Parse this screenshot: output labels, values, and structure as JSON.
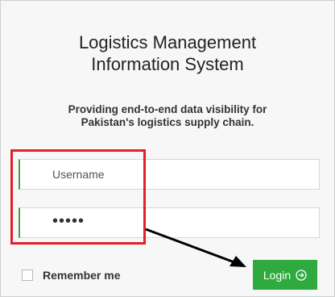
{
  "panel": {
    "title_line1": "Logistics Management",
    "title_line2": "Information System",
    "subtitle_line1": "Providing end-to-end data visibility for",
    "subtitle_line2": "Pakistan's logistics supply chain."
  },
  "form": {
    "username_placeholder": "Username",
    "password_masked": "•••••",
    "remember_label": "Remember me",
    "login_label": "Login"
  },
  "colors": {
    "accent": "#2faa3e",
    "highlight_border": "#e0202a"
  },
  "icons": {
    "login": "arrow-circle-right-icon"
  }
}
